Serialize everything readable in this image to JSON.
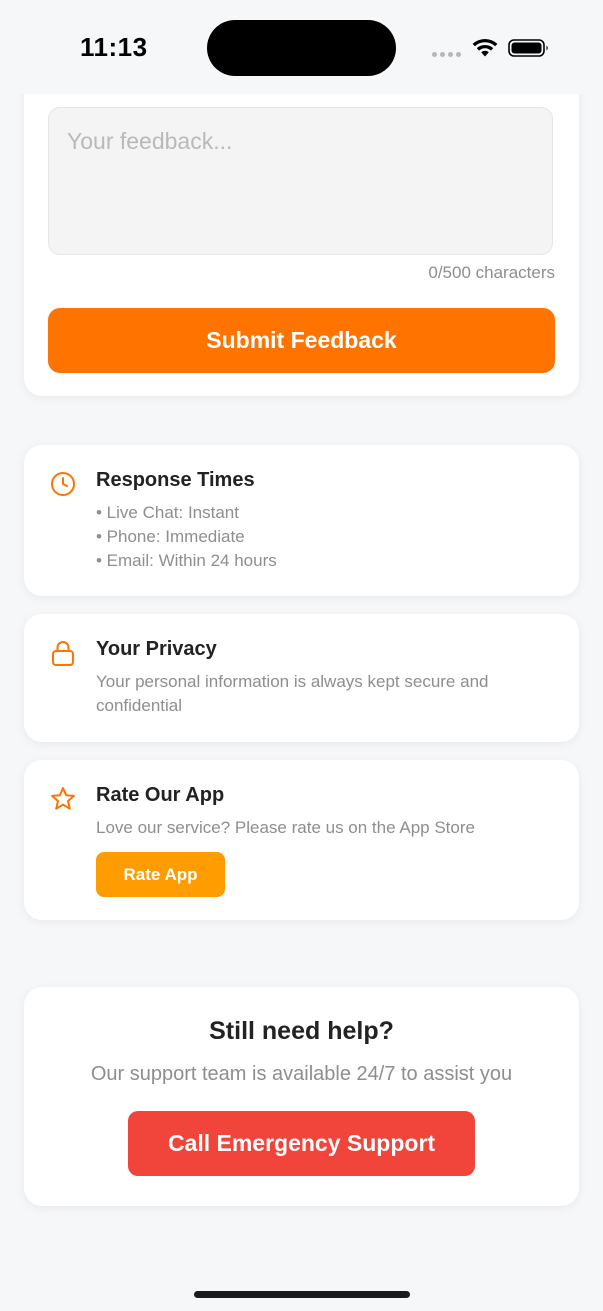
{
  "status_bar": {
    "time": "11:13"
  },
  "feedback": {
    "placeholder": "Your feedback...",
    "value": "",
    "char_count": "0/500 characters",
    "submit_label": "Submit Feedback"
  },
  "response_times": {
    "icon": "clock-icon",
    "title": "Response Times",
    "lines": [
      "• Live Chat: Instant",
      "• Phone: Immediate",
      "• Email: Within 24 hours"
    ]
  },
  "privacy": {
    "icon": "lock-icon",
    "title": "Your Privacy",
    "description": "Your personal information is always kept secure and confidential"
  },
  "rate_app": {
    "icon": "star-icon",
    "title": "Rate Our App",
    "description": "Love our service? Please rate us on the App Store",
    "button_label": "Rate App"
  },
  "help": {
    "title": "Still need help?",
    "description": "Our support team is available 24/7 to assist you",
    "button_label": "Call Emergency Support"
  },
  "colors": {
    "primary_orange": "#ff7300",
    "rate_button": "#ff9c00",
    "emergency_red": "#f1443b",
    "background": "#f6f7f9"
  }
}
